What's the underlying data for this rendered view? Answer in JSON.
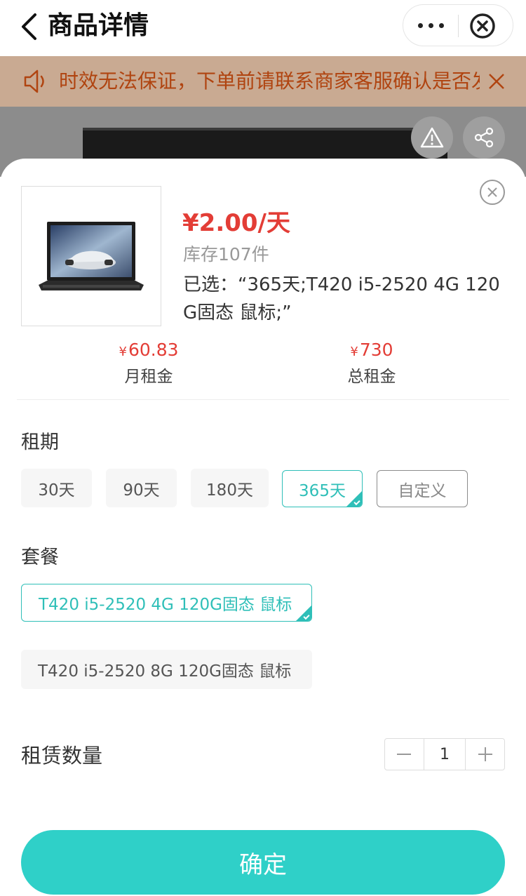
{
  "header": {
    "title": "商品详情"
  },
  "notice": {
    "text": "时效无法保证，下单前请联系商家客服确认是否发货"
  },
  "product": {
    "price": "¥2.00/天",
    "stock": "库存107件",
    "selected": "已选：“365天;T420 i5-2520 4G 120G固态 鼠标;”"
  },
  "summary": {
    "currency": "¥",
    "monthly_value": "60.83",
    "monthly_label": "月租金",
    "total_value": "730",
    "total_label": "总租金"
  },
  "rental_period": {
    "title": "租期",
    "options": [
      "30天",
      "90天",
      "180天",
      "365天",
      "自定义"
    ],
    "selected": "365天"
  },
  "package": {
    "title": "套餐",
    "options": [
      "T420 i5-2520 4G 120G固态 鼠标",
      "T420 i5-2520 8G 120G固态 鼠标"
    ],
    "selected": "T420 i5-2520 4G 120G固态 鼠标"
  },
  "quantity": {
    "label": "租赁数量",
    "value": "1"
  },
  "confirm": {
    "label": "确定"
  },
  "colors": {
    "accent": "#2fd0c8",
    "price": "#e33d36",
    "notice_text": "#b04410"
  }
}
